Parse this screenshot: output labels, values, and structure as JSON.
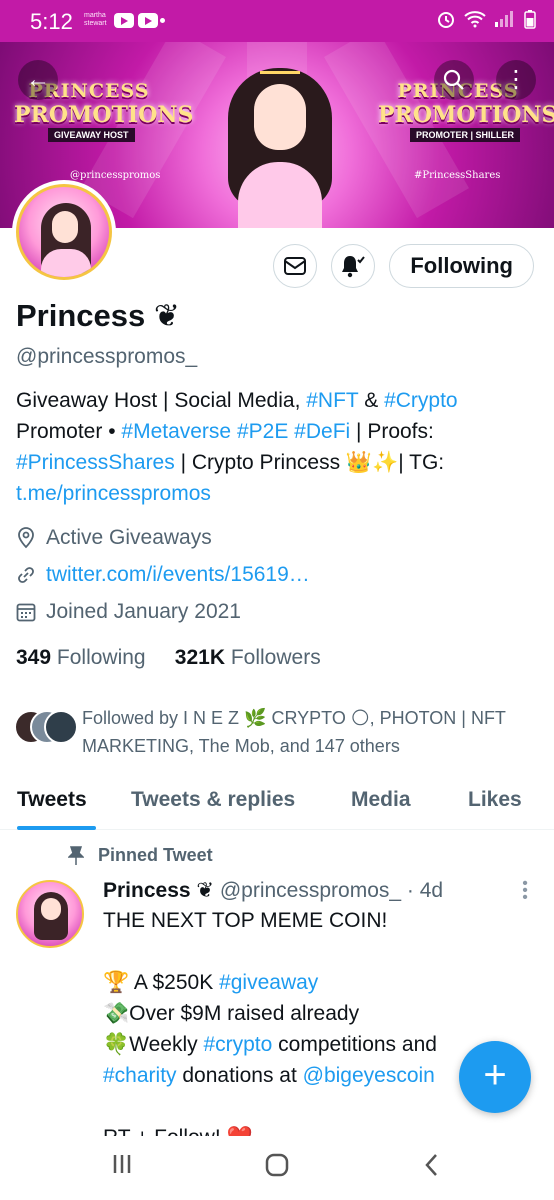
{
  "status_bar": {
    "time": "5:12",
    "small_logo": "martha stewart",
    "icons": [
      "youtube-icon",
      "youtube-icon",
      "alarm-icon",
      "wifi-icon",
      "signal-icon",
      "battery-icon"
    ]
  },
  "banner": {
    "left_brand_line1": "PRINCESS",
    "left_brand_line2": "PROMOTIONS",
    "left_sub": "GIVEAWAY HOST",
    "left_handle": "@princesspromos",
    "right_brand_line1": "PRINCESS",
    "right_brand_line2": "PROMOTIONS",
    "right_sub": "PROMOTER | SHILLER",
    "right_handle": "#PrincessShares"
  },
  "header_buttons": {
    "back": "←",
    "search": "⌕",
    "more": "⋮"
  },
  "profile": {
    "name": "Princess ❦",
    "handle": "@princesspromos_",
    "bio": {
      "p1": "Giveaway Host | Social Media, ",
      "tag_nft": "#NFT",
      "p2": " & ",
      "tag_crypto": "#Crypto",
      "p3": " Promoter • ",
      "tag_metaverse": "#Metaverse",
      "tag_p2e": "#P2E",
      "tag_defi": "#DeFi",
      "p4": " | Proofs: ",
      "tag_shares": "#PrincessShares",
      "p5": " | Crypto Princess 👑✨| TG: ",
      "link_tg": "t.me/princesspromos"
    },
    "location": "Active Giveaways",
    "website": "twitter.com/i/events/15619…",
    "joined": "Joined January 2021",
    "following_count": "349",
    "following_label": "Following",
    "followers_count": "321K",
    "followers_label": "Followers",
    "followed_by": "Followed by I N E Z 🌿 CRYPTO 🌕, PHOTON | NFT MARKETING, The Mob, and 147 others"
  },
  "actions": {
    "following_button": "Following"
  },
  "tabs": [
    "Tweets",
    "Tweets & replies",
    "Media",
    "Likes"
  ],
  "tweet": {
    "pinned_label": "Pinned Tweet",
    "author": "Princess ❦",
    "handle": "@princesspromos_",
    "time": "· 4d",
    "line1": "THE NEXT TOP MEME COIN!",
    "line2_pre": "🏆 A $250K ",
    "line2_tag": "#giveaway",
    "line3": "💸Over $9M raised already",
    "line4_pre": "🍀Weekly ",
    "line4_tag": "#crypto",
    "line4_post": " competitions and",
    "line5_tag": "#charity",
    "line5_mid": " donations at ",
    "line5_mention": "@bigeyescoin",
    "line6": "RT + Follow! ❤️"
  },
  "fab": "+",
  "colors": {
    "status_bar": "#c21aa7",
    "accent": "#1d9bf0",
    "secondary_text": "#536471"
  }
}
